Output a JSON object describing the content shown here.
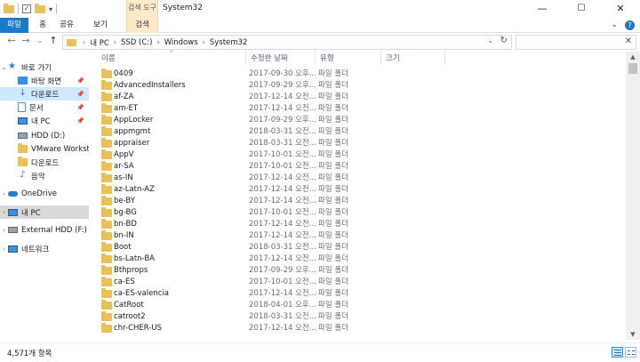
{
  "window": {
    "title": "System32",
    "contextual_tab_group": "검색 도구",
    "controls": {
      "minimize": "—",
      "maximize": "☐",
      "close": "✕"
    }
  },
  "ribbon": {
    "tabs": [
      "파일",
      "홈",
      "공유",
      "보기",
      "검색"
    ],
    "expand_glyph": "⌄",
    "help_glyph": "?"
  },
  "address_bar": {
    "crumbs": [
      "내 PC",
      "SSD (C:)",
      "Windows",
      "System32"
    ],
    "separator": "›",
    "refresh_glyph": "↻",
    "dropdown_glyph": "⌄"
  },
  "search": {
    "placeholder": "",
    "icon_glyph": "✕"
  },
  "nav": {
    "back": "←",
    "forward": "→",
    "recent": "⌄",
    "up": "↑"
  },
  "nav_pane": [
    {
      "label": "바로 가기",
      "icon": "star-icon",
      "expand": "⌄",
      "pinned": false,
      "state": ""
    },
    {
      "label": "바탕 화면",
      "icon": "desktop-icon",
      "pinned": true,
      "state": ""
    },
    {
      "label": "다운로드",
      "icon": "download-icon",
      "pinned": true,
      "state": "selected"
    },
    {
      "label": "문서",
      "icon": "document-icon",
      "pinned": true,
      "state": ""
    },
    {
      "label": "내 PC",
      "icon": "pc-icon",
      "pinned": true,
      "state": ""
    },
    {
      "label": "HDD (D:)",
      "icon": "drive-icon",
      "pinned": false,
      "state": ""
    },
    {
      "label": "VMware Workstatic",
      "icon": "folder-icon",
      "pinned": false,
      "state": ""
    },
    {
      "label": "다운로드",
      "icon": "folder-icon",
      "pinned": false,
      "state": ""
    },
    {
      "label": "음악",
      "icon": "music-icon",
      "pinned": false,
      "state": ""
    },
    {
      "label": "OneDrive",
      "icon": "cloud-icon",
      "expand": "›",
      "pinned": false,
      "state": ""
    },
    {
      "label": "내 PC",
      "icon": "pc-icon",
      "expand": "›",
      "pinned": false,
      "state": "current"
    },
    {
      "label": "External HDD (F:)",
      "icon": "drive-icon",
      "expand": "›",
      "pinned": false,
      "state": ""
    },
    {
      "label": "네트워크",
      "icon": "network-icon",
      "expand": "›",
      "pinned": false,
      "state": ""
    }
  ],
  "columns": [
    "이름",
    "수정한 날짜",
    "유형",
    "크기"
  ],
  "files": [
    {
      "name": "0409",
      "date": "2017-09-30 오후...",
      "type": "파일 폴더"
    },
    {
      "name": "AdvancedInstallers",
      "date": "2017-09-29 오후...",
      "type": "파일 폴더"
    },
    {
      "name": "af-ZA",
      "date": "2017-12-14 오전...",
      "type": "파일 폴더"
    },
    {
      "name": "am-ET",
      "date": "2017-12-14 오전...",
      "type": "파일 폴더"
    },
    {
      "name": "AppLocker",
      "date": "2017-09-29 오후...",
      "type": "파일 폴더"
    },
    {
      "name": "appmgmt",
      "date": "2018-03-31 오전...",
      "type": "파일 폴더"
    },
    {
      "name": "appraiser",
      "date": "2018-03-31 오전...",
      "type": "파일 폴더"
    },
    {
      "name": "AppV",
      "date": "2017-10-01 오전...",
      "type": "파일 폴더"
    },
    {
      "name": "ar-SA",
      "date": "2017-10-01 오전...",
      "type": "파일 폴더"
    },
    {
      "name": "as-IN",
      "date": "2017-12-14 오전...",
      "type": "파일 폴더"
    },
    {
      "name": "az-Latn-AZ",
      "date": "2017-12-14 오전...",
      "type": "파일 폴더"
    },
    {
      "name": "be-BY",
      "date": "2017-12-14 오전...",
      "type": "파일 폴더"
    },
    {
      "name": "bg-BG",
      "date": "2017-10-01 오전...",
      "type": "파일 폴더"
    },
    {
      "name": "bn-BD",
      "date": "2017-12-14 오전...",
      "type": "파일 폴더"
    },
    {
      "name": "bn-IN",
      "date": "2017-12-14 오전...",
      "type": "파일 폴더"
    },
    {
      "name": "Boot",
      "date": "2018-03-31 오전...",
      "type": "파일 폴더"
    },
    {
      "name": "bs-Latn-BA",
      "date": "2017-12-14 오전...",
      "type": "파일 폴더"
    },
    {
      "name": "Bthprops",
      "date": "2017-09-29 오후...",
      "type": "파일 폴더"
    },
    {
      "name": "ca-ES",
      "date": "2017-10-01 오전...",
      "type": "파일 폴더"
    },
    {
      "name": "ca-ES-valencia",
      "date": "2017-12-14 오전...",
      "type": "파일 폴더"
    },
    {
      "name": "CatRoot",
      "date": "2018-04-01 오후...",
      "type": "파일 폴더"
    },
    {
      "name": "catroot2",
      "date": "2018-03-31 오전...",
      "type": "파일 폴더"
    },
    {
      "name": "chr-CHER-US",
      "date": "2017-12-14 오전...",
      "type": "파일 폴더"
    }
  ],
  "status": {
    "item_count": "4,571개 항목"
  },
  "colors": {
    "accent": "#1979ca",
    "context_tab": "#fbe9c9",
    "selected": "#cde8ff",
    "folder": "#e8c15a"
  }
}
